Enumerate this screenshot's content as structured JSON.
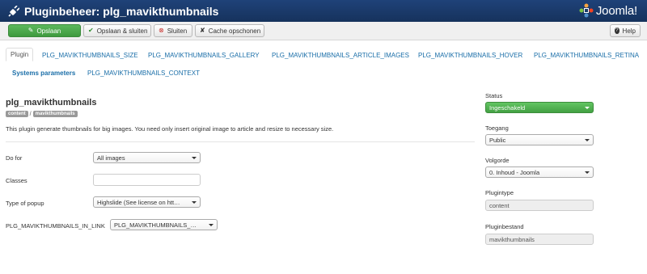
{
  "header": {
    "title": "Pluginbeheer: plg_mavikthumbnails",
    "brand": "Joomla!"
  },
  "toolbar": {
    "save": "Opslaan",
    "save_close": "Opslaan & sluiten",
    "close": "Sluiten",
    "clear_cache": "Cache opschonen",
    "help": "Help"
  },
  "tabs": [
    "Plugin",
    "PLG_MAVIKTHUMBNAILS_SIZE",
    "PLG_MAVIKTHUMBNAILS_GALLERY",
    "PLG_MAVIKTHUMBNAILS_ARTICLE_IMAGES",
    "PLG_MAVIKTHUMBNAILS_HOVER",
    "PLG_MAVIKTHUMBNAILS_RETINA",
    "Systems parameters",
    "PLG_MAVIKTHUMBNAILS_CONTEXT"
  ],
  "plugin": {
    "name": "plg_mavikthumbnails",
    "badge_type": "content",
    "badge_element": "mavikthumbnails",
    "description": "This plugin generate thumbnails for big images. You need only insert original image to article and resize to necessary size."
  },
  "fields": {
    "do_for_label": "Do for",
    "do_for_value": "All images",
    "classes_label": "Classes",
    "classes_value": "",
    "popup_label": "Type of popup",
    "popup_value": "Highslide (See license on htt…",
    "in_link_label": "PLG_MAVIKTHUMBNAILS_IN_LINK",
    "in_link_value": "PLG_MAVIKTHUMBNAILS_…"
  },
  "sidebar": {
    "status_label": "Status",
    "status_value": "Ingeschakeld",
    "access_label": "Toegang",
    "access_value": "Public",
    "order_label": "Volgorde",
    "order_value": "0. Inhoud - Joomla",
    "type_label": "Plugintype",
    "type_value": "content",
    "file_label": "Pluginbestand",
    "file_value": "mavikthumbnails"
  },
  "colors": {
    "header_bg": "#1a3867",
    "save_green": "#46a546",
    "status_green": "#51b351",
    "link_blue": "#1a6ea8"
  }
}
